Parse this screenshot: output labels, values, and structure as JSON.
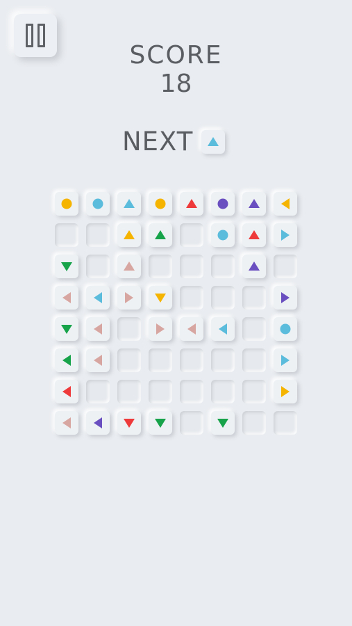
{
  "score": {
    "label": "SCORE",
    "value": "18"
  },
  "next": {
    "label": "NEXT",
    "piece": {
      "shape": "triangle",
      "dir": "up",
      "color": "#5bbcdc"
    }
  },
  "pause": {
    "icon": "pause-icon"
  },
  "board": {
    "rows": [
      [
        {
          "shape": "circle",
          "color": "#f5b400"
        },
        {
          "shape": "circle",
          "color": "#5bbcdc"
        },
        {
          "shape": "triangle",
          "dir": "up",
          "color": "#5bbcdc"
        },
        {
          "shape": "circle",
          "color": "#f5b400"
        },
        {
          "shape": "triangle",
          "dir": "up",
          "color": "#ee3a3a"
        },
        {
          "shape": "circle",
          "color": "#6a4fc0"
        },
        {
          "shape": "triangle",
          "dir": "up",
          "color": "#6a4fc0"
        },
        {
          "shape": "triangle",
          "dir": "left",
          "color": "#f5b400"
        }
      ],
      [
        null,
        null,
        {
          "shape": "triangle",
          "dir": "up",
          "color": "#f5b400"
        },
        {
          "shape": "triangle",
          "dir": "up",
          "color": "#17a34a"
        },
        null,
        {
          "shape": "circle",
          "color": "#5bbcdc"
        },
        {
          "shape": "triangle",
          "dir": "up",
          "color": "#ee3a3a"
        },
        {
          "shape": "triangle",
          "dir": "right",
          "color": "#5bbcdc"
        }
      ],
      [
        {
          "shape": "triangle",
          "dir": "down",
          "color": "#17a34a"
        },
        null,
        {
          "shape": "triangle",
          "dir": "up",
          "color": "#d8a6a0"
        },
        null,
        null,
        null,
        {
          "shape": "triangle",
          "dir": "up",
          "color": "#6a4fc0"
        },
        null
      ],
      [
        {
          "shape": "triangle",
          "dir": "left",
          "color": "#d8a6a0"
        },
        {
          "shape": "triangle",
          "dir": "left",
          "color": "#5bbcdc"
        },
        {
          "shape": "triangle",
          "dir": "right",
          "color": "#d8a6a0"
        },
        {
          "shape": "triangle",
          "dir": "down",
          "color": "#f5b400"
        },
        null,
        null,
        null,
        {
          "shape": "triangle",
          "dir": "right",
          "color": "#6a4fc0"
        }
      ],
      [
        {
          "shape": "triangle",
          "dir": "down",
          "color": "#17a34a"
        },
        {
          "shape": "triangle",
          "dir": "left",
          "color": "#d8a6a0"
        },
        null,
        {
          "shape": "triangle",
          "dir": "right",
          "color": "#d8a6a0"
        },
        {
          "shape": "triangle",
          "dir": "left",
          "color": "#d8a6a0"
        },
        {
          "shape": "triangle",
          "dir": "left",
          "color": "#5bbcdc"
        },
        null,
        {
          "shape": "circle",
          "color": "#5bbcdc"
        }
      ],
      [
        {
          "shape": "triangle",
          "dir": "left",
          "color": "#17a34a"
        },
        {
          "shape": "triangle",
          "dir": "left",
          "color": "#d8a6a0"
        },
        null,
        null,
        null,
        null,
        null,
        {
          "shape": "triangle",
          "dir": "right",
          "color": "#5bbcdc"
        }
      ],
      [
        {
          "shape": "triangle",
          "dir": "left",
          "color": "#ee3a3a"
        },
        null,
        null,
        null,
        null,
        null,
        null,
        {
          "shape": "triangle",
          "dir": "right",
          "color": "#f5b400"
        }
      ],
      [
        {
          "shape": "triangle",
          "dir": "left",
          "color": "#d8a6a0"
        },
        {
          "shape": "triangle",
          "dir": "left",
          "color": "#6a4fc0"
        },
        {
          "shape": "triangle",
          "dir": "down",
          "color": "#ee3a3a"
        },
        {
          "shape": "triangle",
          "dir": "down",
          "color": "#17a34a"
        },
        null,
        {
          "shape": "triangle",
          "dir": "down",
          "color": "#17a34a"
        },
        null,
        null
      ]
    ]
  }
}
